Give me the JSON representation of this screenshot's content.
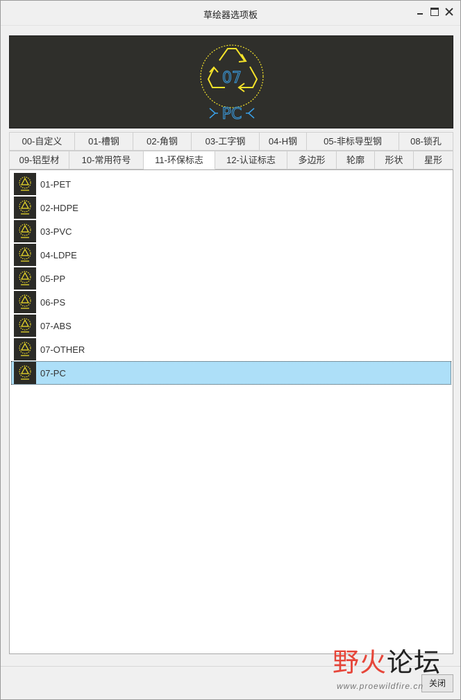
{
  "window": {
    "title": "草绘器选项板"
  },
  "preview": {
    "symbol_number": "07",
    "symbol_code": "PC",
    "accent_color": "#f5e32a",
    "text_color": "#3aa0e8"
  },
  "tabs": {
    "row1": [
      "00-自定义",
      "01-槽钢",
      "02-角钢",
      "03-工字钢",
      "04-H钢",
      "05-非标导型钢",
      "08-锁孔"
    ],
    "row2": [
      "09-铝型材",
      "10-常用符号",
      "11-环保标志",
      "12-认证标志",
      "多边形",
      "轮廓",
      "形状",
      "星形"
    ],
    "active": "11-环保标志"
  },
  "list": {
    "items": [
      "01-PET",
      "02-HDPE",
      "03-PVC",
      "04-LDPE",
      "05-PP",
      "06-PS",
      "07-ABS",
      "07-OTHER",
      "07-PC"
    ],
    "selected": "07-PC",
    "selection_color": "#addff8"
  },
  "footer": {
    "close_label": "关闭"
  },
  "watermark": {
    "wild": "野火",
    "luntan": "论坛",
    "url": "www.proewildfire.cn"
  }
}
